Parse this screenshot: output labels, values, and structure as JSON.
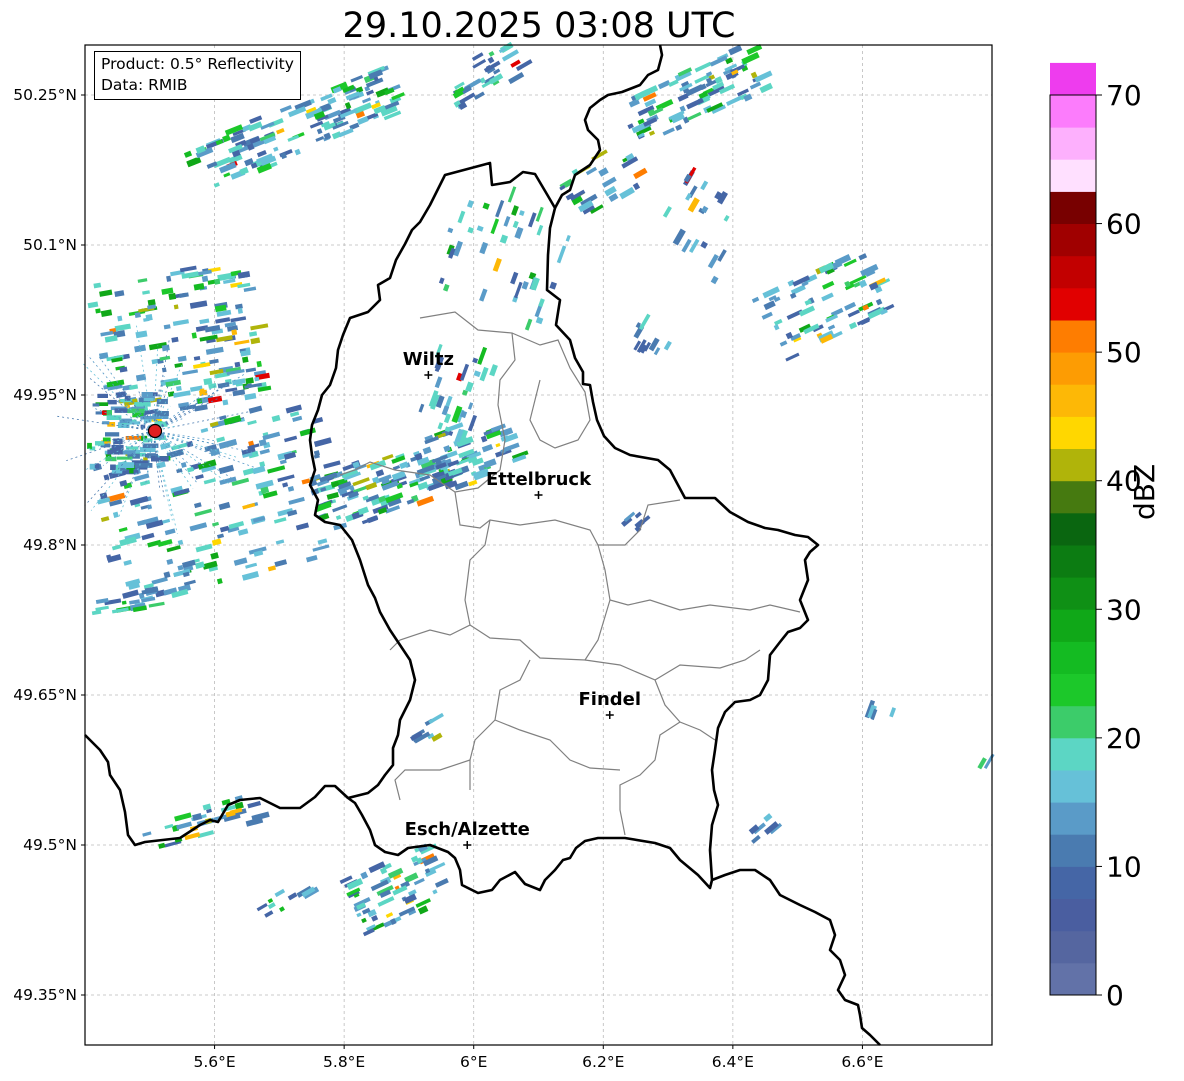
{
  "title": "29.10.2025 03:08 UTC",
  "info_box": {
    "product_line": "Product: 0.5° Reflectivity",
    "data_line": "Data: RMIB"
  },
  "map": {
    "lat_ticks": [
      "50.25°N",
      "50.1°N",
      "49.95°N",
      "49.8°N",
      "49.65°N",
      "49.5°N",
      "49.35°N"
    ],
    "lon_ticks": [
      "5.6°E",
      "5.8°E",
      "6°E",
      "6.2°E",
      "6.4°E",
      "6.6°E"
    ],
    "cities": [
      {
        "name": "Wiltz",
        "lat": 49.97,
        "lon": 5.93
      },
      {
        "name": "Ettelbruck",
        "lat": 49.85,
        "lon": 6.1
      },
      {
        "name": "Findel",
        "lat": 49.63,
        "lon": 6.21
      },
      {
        "name": "Esch/Alzette",
        "lat": 49.5,
        "lon": 5.99
      }
    ],
    "radar_site": {
      "lat": 49.914,
      "lon": 5.505
    },
    "extent": {
      "lon_min": 5.4,
      "lon_max": 6.8,
      "lat_min": 49.3,
      "lat_max": 50.3
    }
  },
  "colorbar": {
    "label": "dBZ",
    "ticks": [
      "0",
      "10",
      "20",
      "30",
      "40",
      "50",
      "60",
      "70"
    ],
    "range": [
      0,
      70
    ],
    "step": 2.5,
    "colors": [
      "#6272a8",
      "#5566a0",
      "#4a5ea0",
      "#4566a6",
      "#4a7bb0",
      "#5a9bc8",
      "#66c1d8",
      "#5cd6c4",
      "#3ccc6a",
      "#1cc82a",
      "#14bb22",
      "#10a818",
      "#0f9015",
      "#0c7c12",
      "#0a6610",
      "#467a10",
      "#b0b40a",
      "#ffd700",
      "#fdb806",
      "#fd9c03",
      "#fe7d01",
      "#e10000",
      "#c20000",
      "#a00000",
      "#780000",
      "#ffe0ff",
      "#fdb0fd",
      "#fc7cfc",
      "#ee3cee"
    ],
    "accent_border": "#000000",
    "grid_color": "#bbbbbb"
  }
}
